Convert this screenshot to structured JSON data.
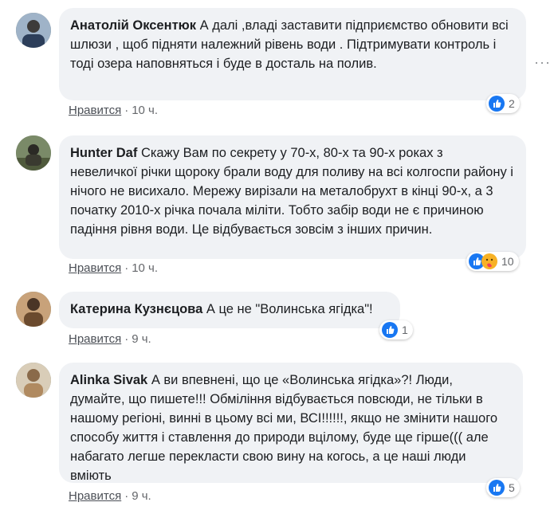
{
  "comments": [
    {
      "author": "Анатолій Оксентюк",
      "text": "А далі ,владі заставити підприємство обновити всі шлюзи , щоб підняти належний рівень води . Підтримувати контроль і тоді озера наповняться і буде в досталь на полив.",
      "like_label": "Нравится",
      "sep": "·",
      "time": "10 ч.",
      "reaction_count": "2"
    },
    {
      "author": "Hunter Daf",
      "text": "Скажу Вам по секрету у 70-х, 80-х та 90-х роках з невеличкої річки щороку брали воду для поливу на всі колгоспи району і нічого не висихало. Мережу вирізали на металобрухт в кінці 90-х, а 3 початку 2010-х річка почала міліти. Тобто забір води не є причиною падіння рівня води. Це відбувається зовсім з інших причин.",
      "like_label": "Нравится",
      "sep": "·",
      "time": "10 ч.",
      "reaction_count": "10"
    },
    {
      "author": "Катерина Кузнєцова",
      "text": "А це не \"Волинська ягідка\"!",
      "like_label": "Нравится",
      "sep": "·",
      "time": "9 ч.",
      "reaction_count": "1"
    },
    {
      "author": "Alinka Sivak",
      "text": "А ви впевнені, що це «Волинська ягідка»?! Люди, думайте, що пишете!!! Обміління відбувається повсюди, не тільки в нашому регіоні, винні в цьому всі ми, ВСІ!!!!!!, якщо не змінити нашого способу життя і ставлення до природи вцілому, буде ще гірше((( але набагато легше перекласти свою вину на когось, а це наші люди вміють",
      "like_label": "Нравится",
      "sep": "·",
      "time": "9 ч.",
      "reaction_count": "5"
    }
  ],
  "more_options": "···",
  "colors": {
    "like_blue": "#1877f2",
    "love_red": "#f33e58",
    "care_yellow": "#f7b125",
    "bubble_bg": "#f0f2f5"
  },
  "icons": [
    "like-reaction-icon",
    "care-reaction-icon",
    "more-options-icon"
  ]
}
